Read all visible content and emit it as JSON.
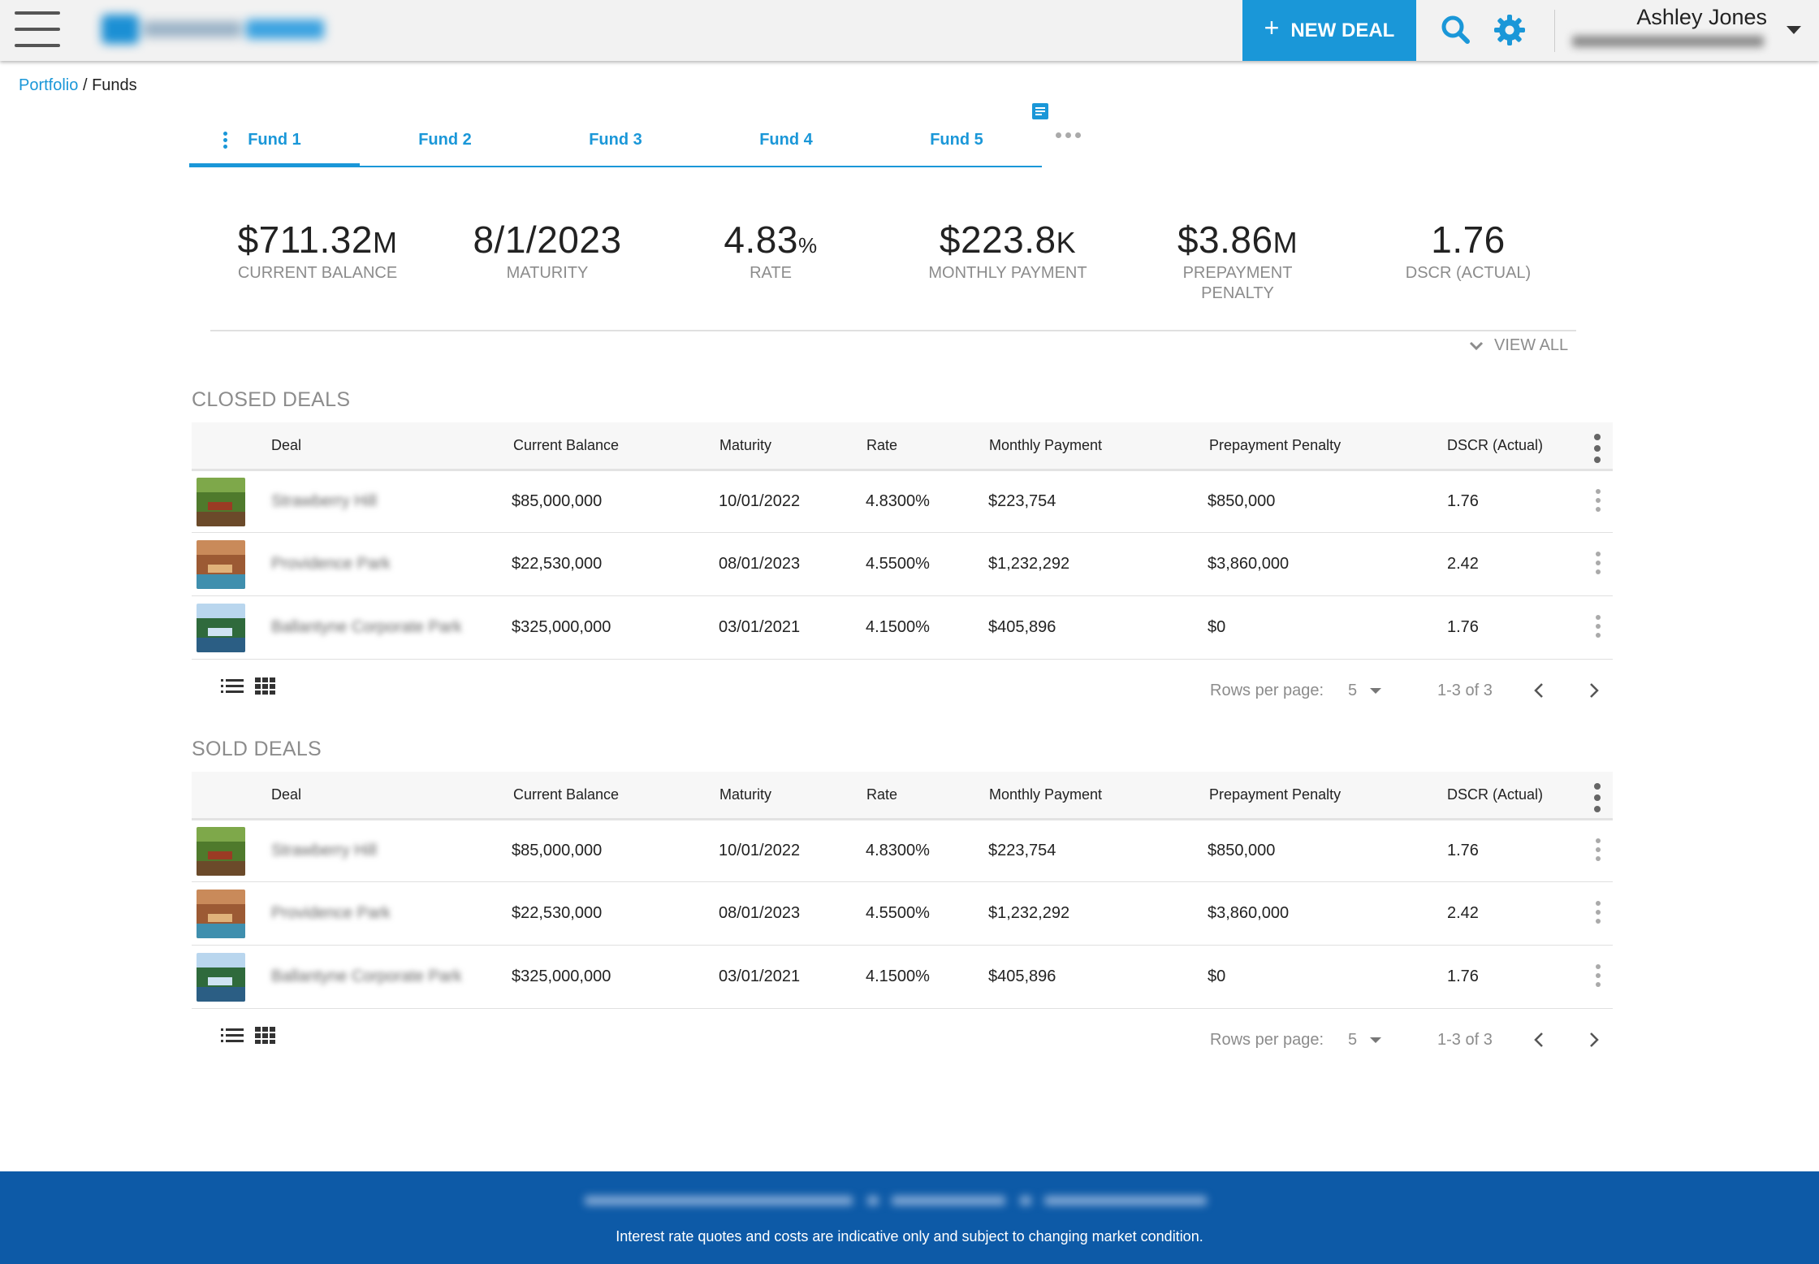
{
  "header": {
    "new_deal_label": "NEW DEAL",
    "user_name": "Ashley Jones",
    "accent_color": "#1a97d8"
  },
  "breadcrumb": {
    "root": "Portfolio",
    "separator": "/",
    "current": "Funds"
  },
  "tabs": [
    {
      "label": "Fund 1",
      "active": true
    },
    {
      "label": "Fund 2",
      "active": false
    },
    {
      "label": "Fund 3",
      "active": false
    },
    {
      "label": "Fund 4",
      "active": false
    },
    {
      "label": "Fund 5",
      "active": false
    }
  ],
  "stats": [
    {
      "value": "$711.32",
      "unit": "M",
      "label": "CURRENT BALANCE"
    },
    {
      "value": "8/1/2023",
      "unit": "",
      "label": "MATURITY"
    },
    {
      "value": "4.83",
      "unit": "%",
      "label": "RATE"
    },
    {
      "value": "$223.8",
      "unit": "K",
      "label": "MONTHLY PAYMENT"
    },
    {
      "value": "$3.86",
      "unit": "M",
      "label": "PREPAYMENT PENALTY"
    },
    {
      "value": "1.76",
      "unit": "",
      "label": "DSCR (ACTUAL)"
    }
  ],
  "view_all_label": "VIEW ALL",
  "columns": [
    "Deal",
    "Current Balance",
    "Maturity",
    "Rate",
    "Monthly Payment",
    "Prepayment Penalty",
    "DSCR (Actual)"
  ],
  "closed_deals": {
    "title": "CLOSED DEALS",
    "rows": [
      {
        "deal": "Strawberry Hill",
        "balance": "$85,000,000",
        "maturity": "10/01/2022",
        "rate": "4.8300%",
        "payment": "$223,754",
        "penalty": "$850,000",
        "dscr": "1.76"
      },
      {
        "deal": "Providence Park",
        "balance": "$22,530,000",
        "maturity": "08/01/2023",
        "rate": "4.5500%",
        "payment": "$1,232,292",
        "penalty": "$3,860,000",
        "dscr": "2.42"
      },
      {
        "deal": "Ballantyne Corporate Park",
        "balance": "$325,000,000",
        "maturity": "03/01/2021",
        "rate": "4.1500%",
        "payment": "$405,896",
        "penalty": "$0",
        "dscr": "1.76"
      }
    ],
    "rows_per_page_label": "Rows per page:",
    "rows_per_page": "5",
    "range": "1-3 of 3"
  },
  "sold_deals": {
    "title": "SOLD DEALS",
    "rows": [
      {
        "deal": "Strawberry Hill",
        "balance": "$85,000,000",
        "maturity": "10/01/2022",
        "rate": "4.8300%",
        "payment": "$223,754",
        "penalty": "$850,000",
        "dscr": "1.76"
      },
      {
        "deal": "Providence Park",
        "balance": "$22,530,000",
        "maturity": "08/01/2023",
        "rate": "4.5500%",
        "payment": "$1,232,292",
        "penalty": "$3,860,000",
        "dscr": "2.42"
      },
      {
        "deal": "Ballantyne Corporate Park",
        "balance": "$325,000,000",
        "maturity": "03/01/2021",
        "rate": "4.1500%",
        "payment": "$405,896",
        "penalty": "$0",
        "dscr": "1.76"
      }
    ],
    "rows_per_page_label": "Rows per page:",
    "rows_per_page": "5",
    "range": "1-3 of 3"
  },
  "footer": {
    "note": "Interest rate quotes and costs are indicative only and subject to changing market condition.",
    "background": "#0d5aa7"
  }
}
